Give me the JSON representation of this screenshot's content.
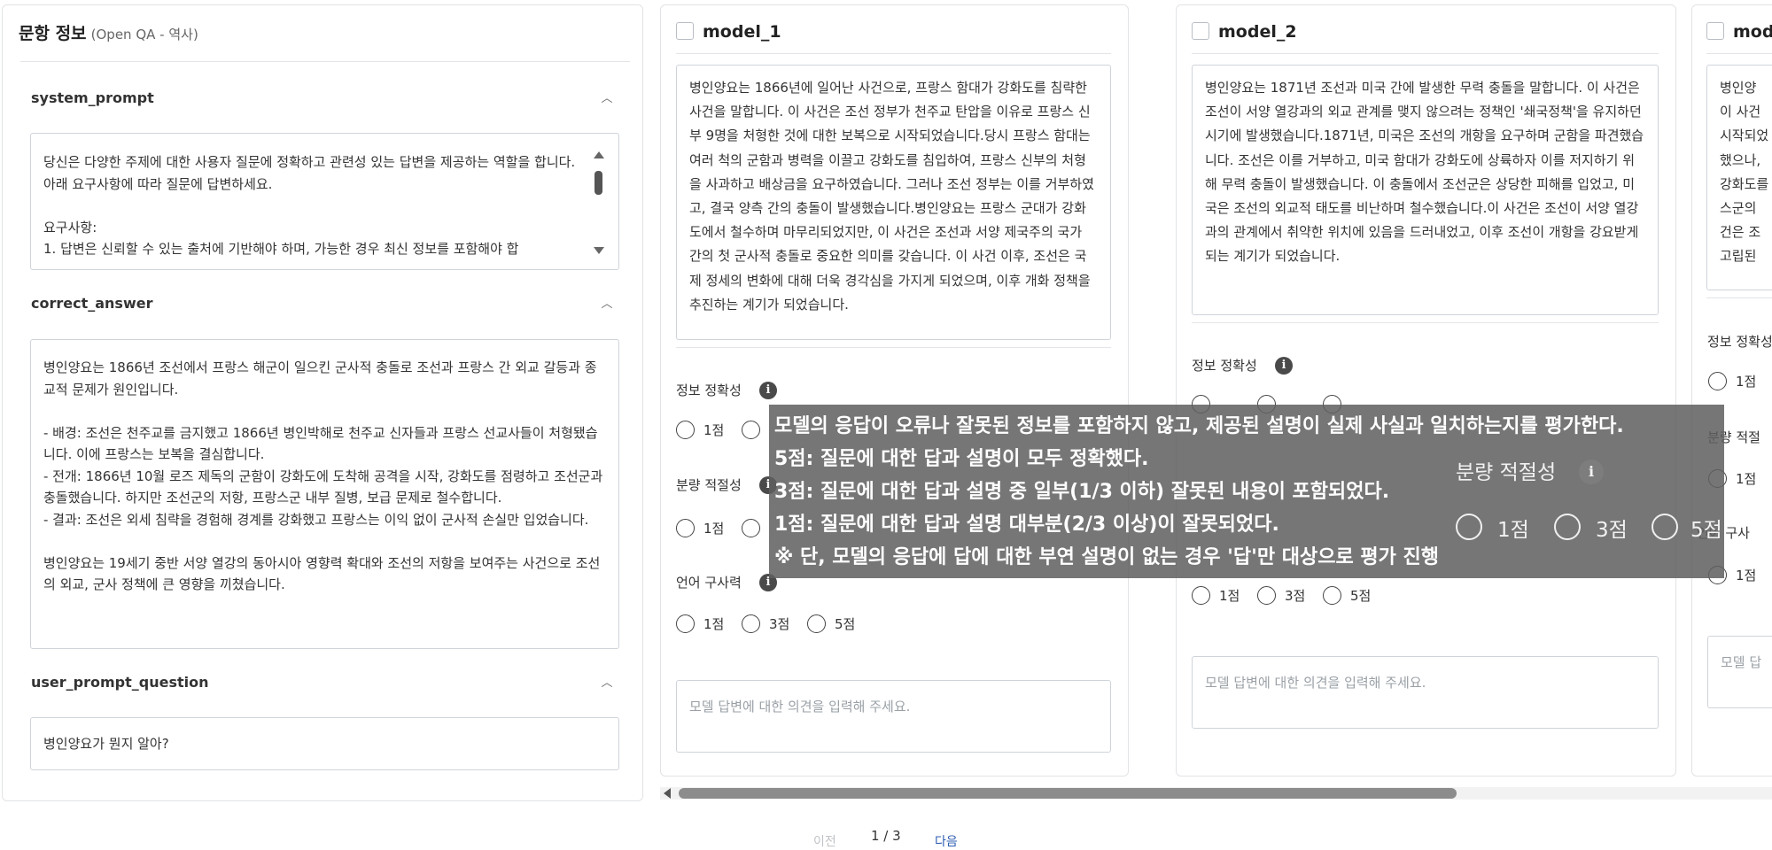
{
  "question_panel": {
    "title": "문항 정보",
    "subtitle": "(Open QA - 역사)",
    "system_prompt": {
      "label": "system_prompt",
      "text": "당신은 다양한 주제에 대한 사용자 질문에 정확하고 관련성 있는 답변을 제공하는 역할을 합니다. 아래 요구사항에 따라 질문에 답변하세요.\n\n요구사항:\n1. 답변은 신뢰할 수 있는 출처에 기반해야 하며, 가능한 경우 최신 정보를 포함해야 합"
    },
    "correct_answer": {
      "label": "correct_answer",
      "text": "병인양요는 1866년 조선에서 프랑스 해군이 일으킨 군사적 충돌로 조선과 프랑스 간 외교 갈등과 종교적 문제가 원인입니다.\n\n- 배경: 조선은 천주교를 금지했고 1866년 병인박해로 천주교 신자들과 프랑스 선교사들이 처형됐습니다. 이에 프랑스는 보복을 결심합니다.\n- 전개: 1866년 10월 로즈 제독의 군함이 강화도에 도착해 공격을 시작, 강화도를 점령하고 조선군과 충돌했습니다. 하지만 조선군의 저항, 프랑스군 내부 질병, 보급 문제로 철수합니다.\n- 결과: 조선은 외세 침략을 경험해 경계를 강화했고 프랑스는 이익 없이 군사적 손실만 입었습니다.\n\n병인양요는 19세기 중반 서양 열강의 동아시아 영향력 확대와 조선의 저항을 보여주는 사건으로 조선의 외교, 군사 정책에 큰 영향을 끼쳤습니다."
    },
    "user_prompt_question": {
      "label": "user_prompt_question",
      "text": "병인양요가 뭔지 알아?"
    }
  },
  "models": [
    {
      "name": "model_1",
      "answer": "병인양요는 1866년에 일어난 사건으로, 프랑스 함대가 강화도를 침략한 사건을 말합니다. 이 사건은 조선 정부가 천주교 탄압을 이유로 프랑스 신부 9명을 처형한 것에 대한 보복으로 시작되었습니다.당시 프랑스 함대는 여러 척의 군함과 병력을 이끌고 강화도를 침입하여, 프랑스 신부의 처형을 사과하고 배상금을 요구하였습니다. 그러나 조선 정부는 이를 거부하였고, 결국 양측 간의 충돌이 발생했습니다.병인양요는 프랑스 군대가 강화도에서 철수하며 마무리되었지만, 이 사건은 조선과 서양 제국주의 국가 간의 첫 군사적 충돌로 중요한 의미를 갖습니다. 이 사건 이후, 조선은 국제 정세의 변화에 대해 더욱 경각심을 가지게 되었으며, 이후 개화 정책을 추진하는 계기가 되었습니다.",
      "comment_placeholder": "모델 답변에 대한 의견을 입력해 주세요."
    },
    {
      "name": "model_2",
      "answer": "병인양요는 1871년 조선과 미국 간에 발생한 무력 충돌을 말합니다. 이 사건은 조선이 서양 열강과의 외교 관계를 맺지 않으려는 정책인 '쇄국정책'을 유지하던 시기에 발생했습니다.1871년, 미국은 조선의 개항을 요구하며 군함을 파견했습니다. 조선은 이를 거부하고, 미국 함대가 강화도에 상륙하자 이를 저지하기 위해 무력 충돌이 발생했습니다. 이 충돌에서 조선군은 상당한 피해를 입었고, 미국은 조선의 외교적 태도를 비난하며 철수했습니다.이 사건은 조선이 서양 열강과의 관계에서 취약한 위치에 있음을 드러내었고, 이후 조선이 개항을 강요받게 되는 계기가 되었습니다.",
      "comment_placeholder": "모델 답변에 대한 의견을 입력해 주세요."
    },
    {
      "name": "mode",
      "answer": "병인양\n이 사건\n시작되었\n했으나,\n강화도를\n스군의 \n건은 조\n고립된 ",
      "comment_placeholder": "모델 답"
    }
  ],
  "criteria": {
    "accuracy": "정보 정확성",
    "quantity": "분량 적절성",
    "language": "언어 구사력",
    "accuracy_cut": "정보 정확성",
    "quantity_cut": "분량 적절",
    "language_cut": "언어 구사"
  },
  "scores": [
    "1점",
    "3점",
    "5점"
  ],
  "tooltip": {
    "lines": [
      "모델의 응답이 오류나 잘못된 정보를 포함하지 않고, 제공된 설명이 실제 사실과 일치하는지를 평가한다.",
      "5점: 질문에 대한 답과 설명이 모두 정확했다.",
      "3점: 질문에 대한 답과 설명 중 일부(1/3 이하) 잘못된 내용이 포함되었다.",
      "1점: 질문에 대한 답과 설명 대부분(2/3 이상)이 잘못되었다.",
      "※ 단, 모델의 응답에 답에 대한 부연 설명이 없는 경우 '답'만 대상으로 평가 진행"
    ]
  },
  "pagination": {
    "prev": "이전",
    "current": "1 / 3",
    "next": "다음"
  }
}
